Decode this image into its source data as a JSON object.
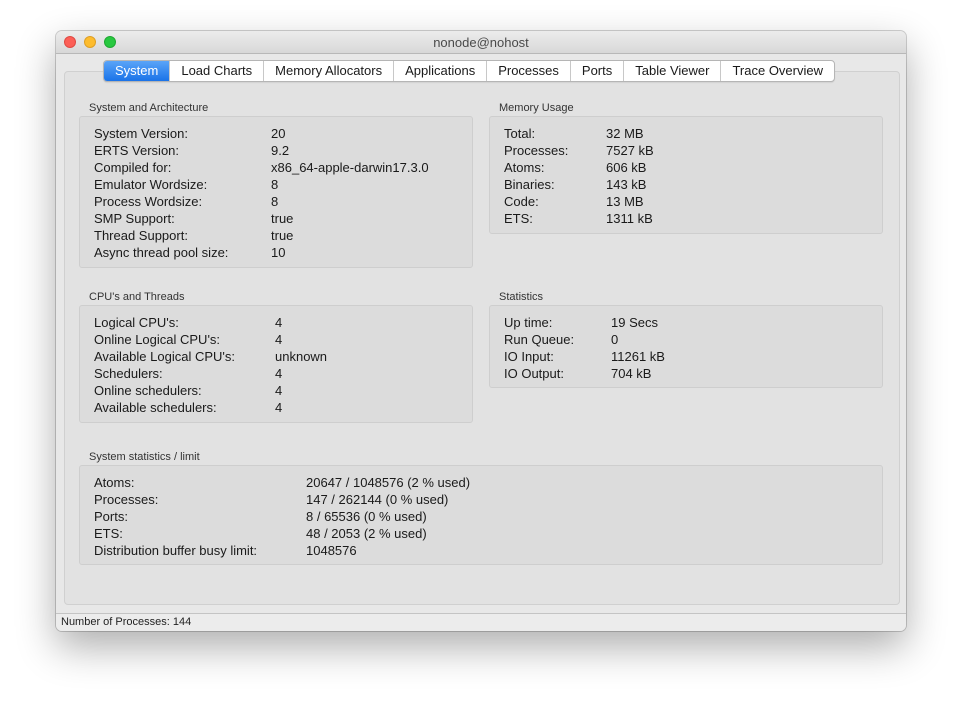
{
  "window": {
    "title": "nonode@nohost"
  },
  "tabs": [
    {
      "label": "System",
      "active": true
    },
    {
      "label": "Load Charts"
    },
    {
      "label": "Memory Allocators"
    },
    {
      "label": "Applications"
    },
    {
      "label": "Processes"
    },
    {
      "label": "Ports"
    },
    {
      "label": "Table Viewer"
    },
    {
      "label": "Trace Overview"
    }
  ],
  "system_arch": {
    "title": "System and Architecture",
    "rows": [
      {
        "label": "System Version:",
        "value": "20"
      },
      {
        "label": "ERTS Version:",
        "value": "9.2"
      },
      {
        "label": "Compiled for:",
        "value": "x86_64-apple-darwin17.3.0"
      },
      {
        "label": "Emulator Wordsize:",
        "value": "8"
      },
      {
        "label": "Process Wordsize:",
        "value": "8"
      },
      {
        "label": "SMP Support:",
        "value": "true"
      },
      {
        "label": "Thread Support:",
        "value": "true"
      },
      {
        "label": "Async thread pool size:",
        "value": "10"
      }
    ]
  },
  "memory": {
    "title": "Memory Usage",
    "rows": [
      {
        "label": "Total:",
        "value": "32 MB"
      },
      {
        "label": "Processes:",
        "value": "7527 kB"
      },
      {
        "label": "Atoms:",
        "value": "606 kB"
      },
      {
        "label": "Binaries:",
        "value": "143 kB"
      },
      {
        "label": "Code:",
        "value": "13 MB"
      },
      {
        "label": "ETS:",
        "value": "1311 kB"
      }
    ]
  },
  "cpu": {
    "title": "CPU's and Threads",
    "rows": [
      {
        "label": "Logical CPU's:",
        "value": "4"
      },
      {
        "label": "Online Logical CPU's:",
        "value": "4"
      },
      {
        "label": "Available Logical CPU's:",
        "value": "unknown"
      },
      {
        "label": "Schedulers:",
        "value": "4"
      },
      {
        "label": "Online schedulers:",
        "value": "4"
      },
      {
        "label": "Available schedulers:",
        "value": "4"
      }
    ]
  },
  "statistics": {
    "title": "Statistics",
    "rows": [
      {
        "label": "Up time:",
        "value": "19 Secs"
      },
      {
        "label": "Run Queue:",
        "value": "0"
      },
      {
        "label": "IO Input:",
        "value": "11261 kB"
      },
      {
        "label": "IO Output:",
        "value": "704 kB"
      }
    ]
  },
  "limits": {
    "title": "System statistics / limit",
    "rows": [
      {
        "label": "Atoms:",
        "value": "20647 / 1048576 (2 % used)"
      },
      {
        "label": "Processes:",
        "value": "147 / 262144 (0 % used)"
      },
      {
        "label": "Ports:",
        "value": "8 / 65536 (0 % used)"
      },
      {
        "label": "ETS:",
        "value": "48 / 2053 (2 % used)"
      },
      {
        "label": "Distribution buffer busy limit:",
        "value": "1048576"
      }
    ]
  },
  "statusbar": {
    "text": "Number of Processes: 144"
  }
}
